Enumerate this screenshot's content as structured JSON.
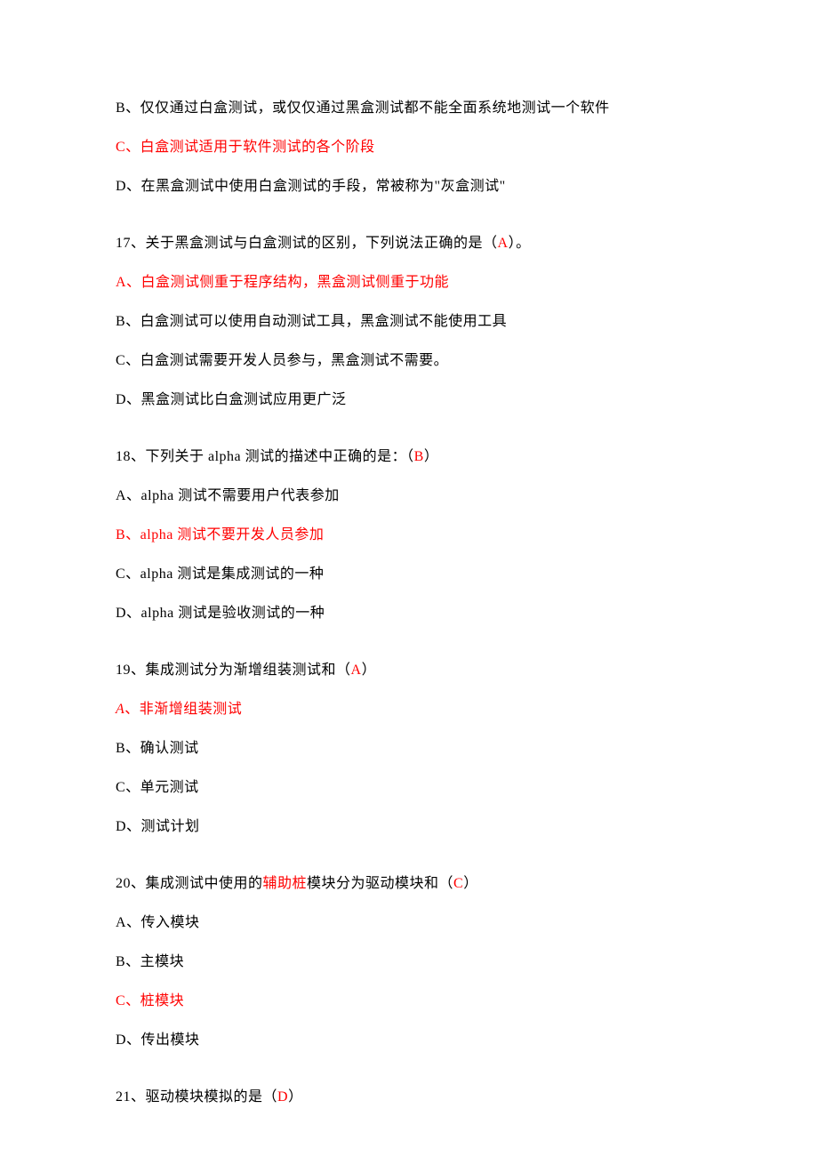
{
  "q16": {
    "b": "B、仅仅通过白盒测试，或仅仅通过黑盒测试都不能全面系统地测试一个软件",
    "c": "C、白盒测试适用于软件测试的各个阶段",
    "d_part1": "D、在黑盒测试中使用白盒测试的手段，常被称为\"灰盒测试\""
  },
  "q17": {
    "stem_part1": "17、关于黑盒测试与白盒测试的区别，下列说法正确的是（",
    "stem_ans": "A",
    "stem_part2": "）。",
    "a": "A、白盒测试侧重于程序结构，黑盒测试侧重于功能",
    "b": "B、白盒测试可以使用自动测试工具，黑盒测试不能使用工具",
    "c": "C、白盒测试需要开发人员参与，黑盒测试不需要。",
    "d": "D、黑盒测试比白盒测试应用更广泛"
  },
  "q18": {
    "stem_part1": "18、下列关于 alpha 测试的描述中正确的是：（",
    "stem_ans": "B",
    "stem_part2": "）",
    "a": "A、alpha 测试不需要用户代表参加",
    "b": "B、alpha 测试不要开发人员参加",
    "c": "C、alpha 测试是集成测试的一种",
    "d": "D、alpha 测试是验收测试的一种"
  },
  "q19": {
    "stem_part1": "19、集成测试分为渐增组装测试和（",
    "stem_ans": "A",
    "stem_part2": "）",
    "a_letter": "A",
    "a_rest": "、非渐增组装测试",
    "b": "B、确认测试",
    "c": "C、单元测试",
    "d": "D、测试计划"
  },
  "q20": {
    "stem_part1": "20、集成测试中使用的",
    "stem_red1": "辅助桩",
    "stem_part2": "模块分为驱动模块和（",
    "stem_ans": "C",
    "stem_part3": "）",
    "a": "A、传入模块",
    "b": "B、主模块",
    "c": "C、桩模块",
    "d": "D、传出模块"
  },
  "q21": {
    "stem_part1": "21、驱动模块模拟的是（",
    "stem_ans": "D",
    "stem_part2": "）"
  }
}
